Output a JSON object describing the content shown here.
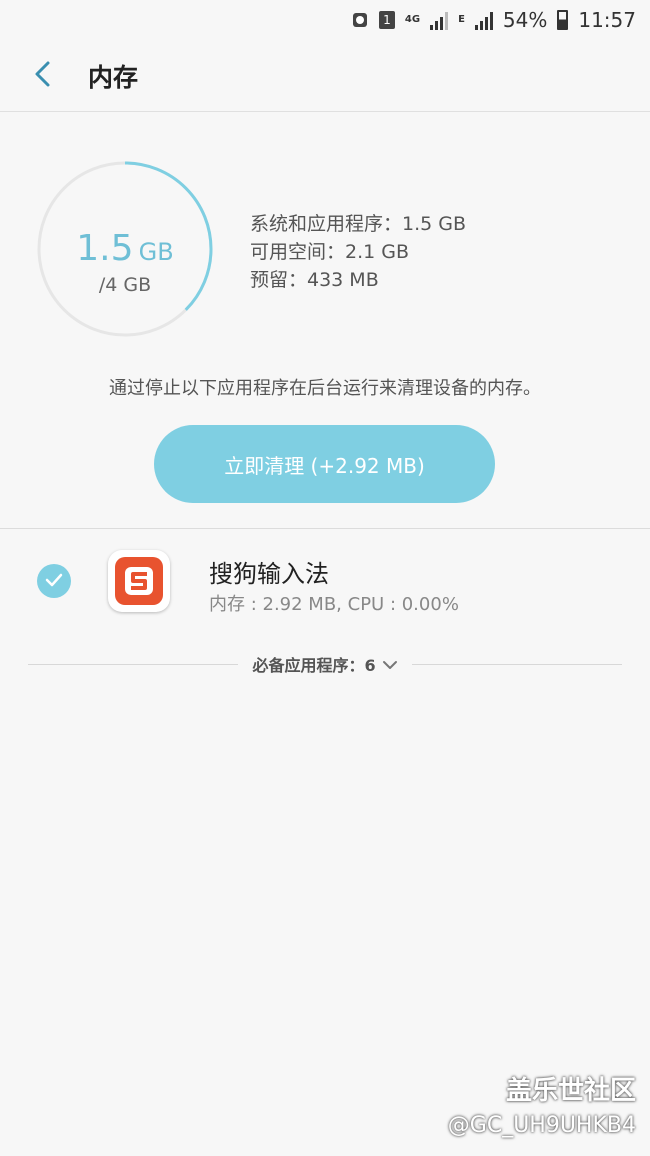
{
  "status_bar": {
    "sim": "1",
    "network_4g": "4G",
    "network_e": "E",
    "battery": "54%",
    "time": "11:57"
  },
  "header": {
    "title": "内存"
  },
  "memory": {
    "used_value": "1.5",
    "used_unit": "GB",
    "total": "/4 GB",
    "used_fraction": 0.375,
    "stats": [
      "系统和应用程序：1.5 GB",
      "可用空间：2.1 GB",
      "预留：433 MB"
    ]
  },
  "hint": "通过停止以下应用程序在后台运行来清理设备的内存。",
  "clean_button": "立即清理 (+2.92 MB)",
  "apps": [
    {
      "name": "搜狗输入法",
      "stats": "内存 : 2.92 MB, CPU : 0.00%",
      "checked": true
    }
  ],
  "essentials": {
    "label": "必备应用程序：6"
  },
  "watermark": {
    "line1": "盖乐世社区",
    "line2": "@GC_UH9UHKB4"
  },
  "colors": {
    "accent": "#7fcfe2",
    "ring_track": "#e6e6e6",
    "ring_used": "#7fcfe2"
  }
}
